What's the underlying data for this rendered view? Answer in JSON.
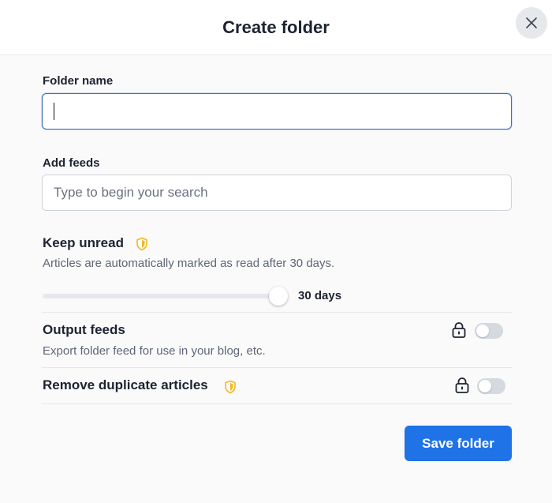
{
  "dialog": {
    "title": "Create folder"
  },
  "folder_name": {
    "label": "Folder name",
    "value": "",
    "placeholder": ""
  },
  "add_feeds": {
    "label": "Add feeds",
    "placeholder": "Type to begin your search"
  },
  "keep_unread": {
    "title": "Keep unread",
    "description": "Articles are automatically marked as read after 30 days.",
    "slider_value_label": "30 days",
    "slider_fraction": 1.0,
    "icon": "shield-icon"
  },
  "output_feeds": {
    "title": "Output feeds",
    "description": "Export folder feed for use in your blog, etc.",
    "locked": true,
    "enabled": false
  },
  "remove_duplicates": {
    "title": "Remove duplicate articles",
    "icon": "shield-icon",
    "locked": true,
    "enabled": false
  },
  "actions": {
    "save_label": "Save folder"
  },
  "colors": {
    "accent": "#1f73e6",
    "premium_shield": "#f2b91f",
    "toggle_off": "#d5d9e0"
  }
}
